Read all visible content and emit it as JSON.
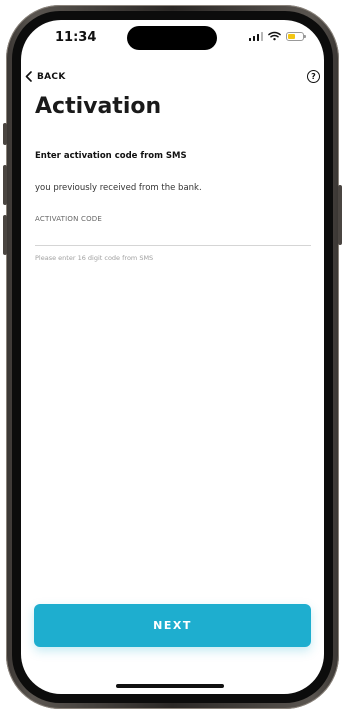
{
  "status_bar": {
    "time": "11:34",
    "battery_color": "#f3c614"
  },
  "nav": {
    "back_label": "BACK",
    "back_icon": "chevron-left-icon",
    "help_icon": "help-circle-icon",
    "help_glyph": "?"
  },
  "page": {
    "title": "Activation",
    "subtitle": "Enter activation code from SMS",
    "description": "you previously received from the bank."
  },
  "activation_field": {
    "label": "ACTIVATION CODE",
    "value": "",
    "hint": "Please enter 16 digit code from SMS"
  },
  "actions": {
    "next_label": "NEXT",
    "accent_color": "#1eaecf"
  }
}
